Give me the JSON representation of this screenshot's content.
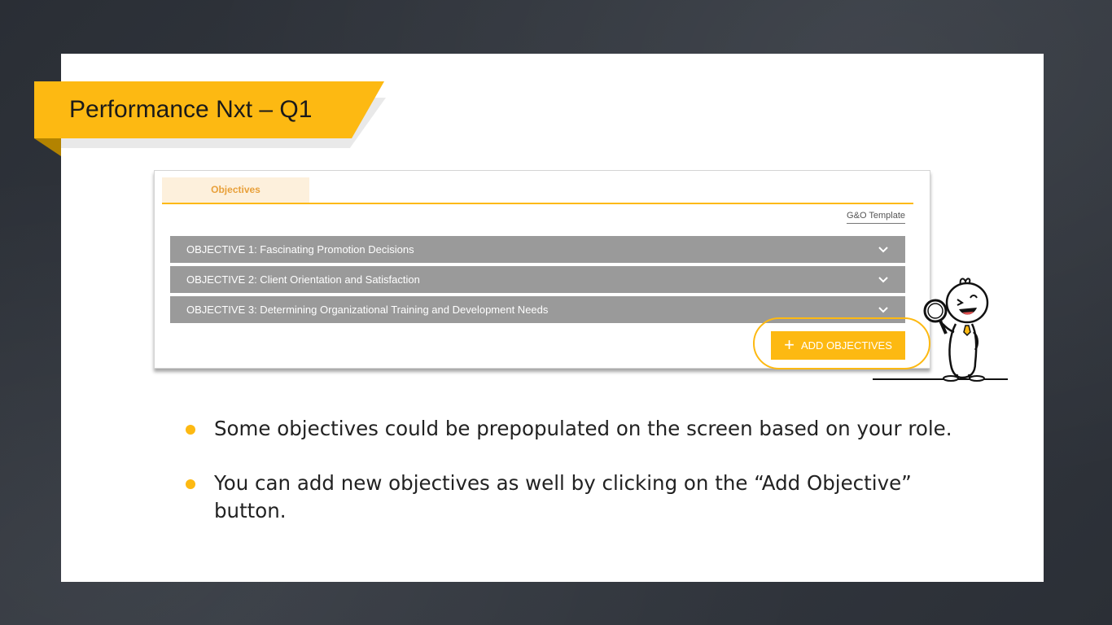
{
  "slide": {
    "title": "Performance Nxt – Q1"
  },
  "app": {
    "tab_label": "Objectives",
    "template_link": "G&O Template",
    "objectives": [
      {
        "label": "OBJECTIVE 1: Fascinating Promotion Decisions"
      },
      {
        "label": "OBJECTIVE 2: Client Orientation and Satisfaction"
      },
      {
        "label": "OBJECTIVE 3: Determining Organizational Training and Development Needs"
      }
    ],
    "add_button_label": "ADD OBJECTIVES",
    "add_button_icon": "plus-icon",
    "row_icon": "chevron-down-icon"
  },
  "bullets": [
    "Some objectives could be prepopulated on the screen based on your role.",
    "You can add new objectives as well by clicking on the “Add Objective” button."
  ],
  "colors": {
    "accent": "#fdb912",
    "row_gray": "#9a9a9a",
    "tab_text": "#e8a03a"
  }
}
